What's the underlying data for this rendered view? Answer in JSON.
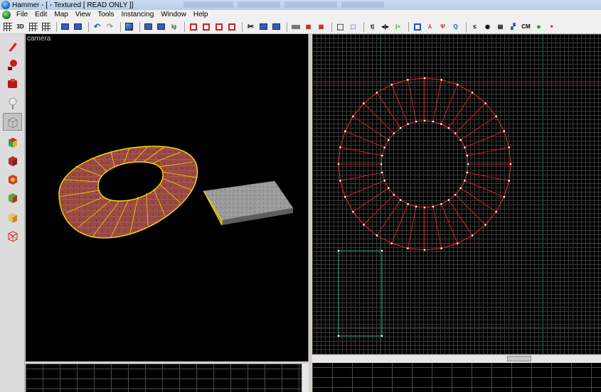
{
  "window": {
    "title": "Hammer - [ - Textured [ READ ONLY ]]"
  },
  "menu": [
    "File",
    "Edit",
    "Map",
    "View",
    "Tools",
    "Instancing",
    "Window",
    "Help"
  ],
  "toolbar": {
    "3d_label": "3D",
    "cm_label": "CM"
  },
  "tools": [
    {
      "name": "selection-tool",
      "color": "#d62a2a"
    },
    {
      "name": "magnify-tool",
      "color": "#c81e1e"
    },
    {
      "name": "camera-tool",
      "color": "#b81818"
    },
    {
      "name": "entity-tool",
      "color": "#e0e0e0"
    },
    {
      "name": "block-tool",
      "color": "#c0c0c0"
    },
    {
      "name": "texture-application-tool",
      "color": "#3aa23a"
    },
    {
      "name": "apply-current-texture-tool",
      "color": "#b03030"
    },
    {
      "name": "decal-tool",
      "color": "#d03a2a"
    },
    {
      "name": "overlay-tool",
      "color": "#6aa03a"
    },
    {
      "name": "clipping-tool",
      "color": "#e8c060"
    },
    {
      "name": "vertex-tool",
      "color": "#c82828"
    }
  ],
  "viewports": {
    "camera_label": "camera"
  },
  "colors": {
    "selection": "#ff2020",
    "face_highlight": "#ffd400",
    "grid": "#3a3a3a",
    "brush_outline": "#2a9a7a"
  }
}
